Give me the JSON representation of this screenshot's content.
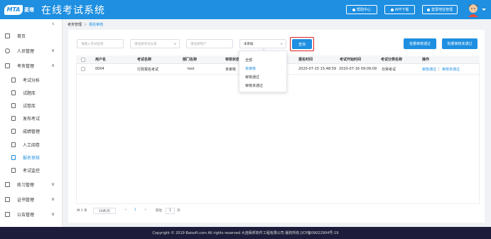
{
  "header": {
    "logo_badge": "MTA",
    "logo_text": "麦塔",
    "title": "在线考试系统",
    "help_label": "帮助中心",
    "app_label": "APP下载",
    "logout_label": "登录地址管理"
  },
  "sidebar": {
    "items": [
      {
        "label": "首页",
        "icon": "home-icon"
      },
      {
        "label": "人员管理",
        "icon": "user-icon",
        "chevron": "∨"
      },
      {
        "label": "考务管理",
        "icon": "exam-icon",
        "chevron": "∧"
      },
      {
        "label": "考试分析",
        "icon": "analysis-icon"
      },
      {
        "label": "试题库",
        "icon": "question-bank-icon"
      },
      {
        "label": "试卷库",
        "icon": "paper-bank-icon"
      },
      {
        "label": "发布考试",
        "icon": "publish-icon"
      },
      {
        "label": "成绩管理",
        "icon": "score-icon"
      },
      {
        "label": "人工阅卷",
        "icon": "grading-icon"
      },
      {
        "label": "报名审核",
        "icon": "review-icon"
      },
      {
        "label": "考试监控",
        "icon": "monitor-icon"
      },
      {
        "label": "练习管理",
        "icon": "practice-icon",
        "chevron": "∨"
      },
      {
        "label": "证书管理",
        "icon": "certificate-icon",
        "chevron": "∨"
      },
      {
        "label": "公告管理",
        "icon": "notice-icon",
        "chevron": "∨"
      }
    ]
  },
  "breadcrumb": {
    "parent": "考务管理",
    "sep": ">",
    "current": "报名审核"
  },
  "filters": {
    "exam_name_placeholder": "请输入考试名称",
    "category_placeholder": "请选择考试分类",
    "user_placeholder": "请选择用户",
    "status_value": "未审核",
    "query_label": "查询",
    "batch_approve_label": "批量审核通过",
    "batch_reject_label": "批量审核未通过"
  },
  "dropdown": {
    "options": [
      "全部",
      "未审核",
      "审核通过",
      "审核未通过"
    ],
    "selected_index": 1
  },
  "table": {
    "headers": [
      "用户名",
      "考试名称",
      "部门名称",
      "审核状态",
      "报名时间",
      "考试开始时间",
      "考试分类名称",
      "操作"
    ],
    "rows": [
      {
        "username": "0004",
        "exam": "行政报名考试",
        "dept": "test",
        "status": "未审核",
        "signup_time": "2020-07-15 15:48:59",
        "start_time": "2020-07-16 09:09:09",
        "category": "日常考试",
        "action_approve": "审核通过",
        "action_sep": "|",
        "action_reject": "审核未通过"
      }
    ]
  },
  "pagination": {
    "total": "共 1 条",
    "page_size": "10条/页",
    "prev": "<",
    "page": "1",
    "next": ">",
    "goto_label": "前往",
    "goto_value": "1",
    "page_suffix": "页"
  },
  "footer": {
    "text": "Copyright © 2019 Baisoft.com All rights reserved 大连栢邦软件工程有限公司 版权所有 [ICP备09022904号-19"
  },
  "colors": {
    "accent": "#1e8fe1",
    "footer_bg": "#1d1d3b",
    "highlight_border": "#e02020"
  }
}
